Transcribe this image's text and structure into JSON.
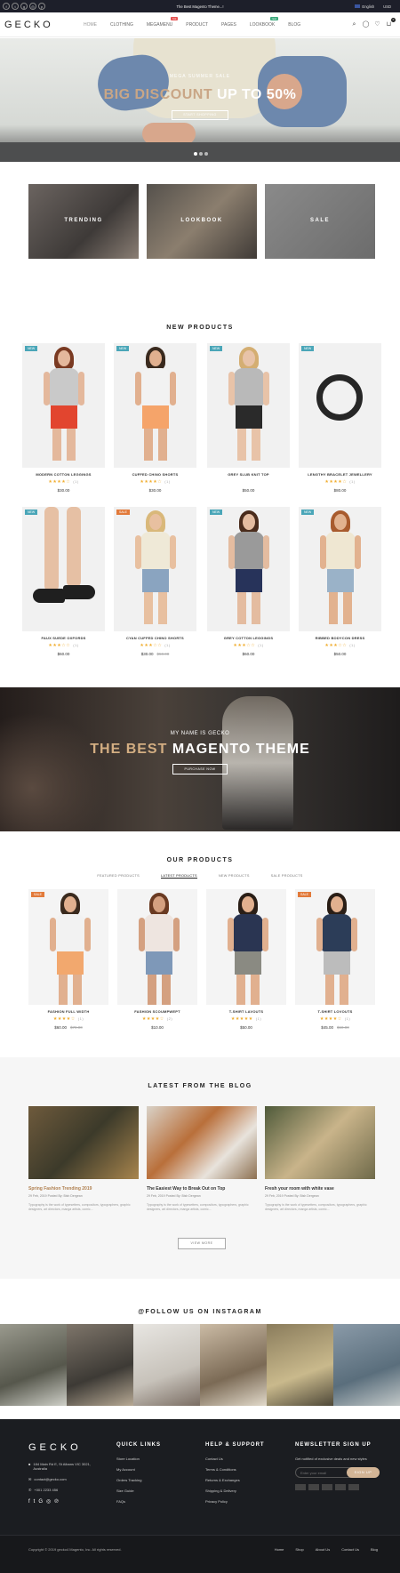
{
  "topbar": {
    "promo": "The Best Magento Theme...!",
    "language": "English",
    "currency": "USD",
    "social_icons": [
      "facebook-icon",
      "twitter-icon",
      "google-plus-icon",
      "instagram-icon",
      "pinterest-icon"
    ]
  },
  "header": {
    "logo": "GECKO",
    "nav": [
      {
        "label": "HOME"
      },
      {
        "label": "CLOTHING"
      },
      {
        "label": "MEGAMENU",
        "badge": "hot"
      },
      {
        "label": "PRODUCT"
      },
      {
        "label": "PAGES"
      },
      {
        "label": "LOOKBOOK",
        "badge": "new"
      },
      {
        "label": "BLOG"
      }
    ],
    "icons": [
      "search-icon",
      "user-icon",
      "heart-icon",
      "cart-icon"
    ],
    "cart_count": "0"
  },
  "hero": {
    "subtitle": "MEGA SUMMER SALE",
    "title_a": "BIG DISCOUNT",
    "title_b": " UP TO 50%",
    "button": "START SHOPPING"
  },
  "categories": [
    "TRENDING",
    "LOOKBOOK",
    "SALE"
  ],
  "new_products": {
    "title": "NEW PRODUCTS",
    "items": [
      {
        "tag": "NEW",
        "name": "MODERN COTTON LEGGINGS",
        "stars": "★★★★☆",
        "reviews": "(1)",
        "price": "$30.00",
        "old": ""
      },
      {
        "tag": "NEW",
        "name": "CUFFED CHINO SHORTS",
        "stars": "★★★★☆",
        "reviews": "(1)",
        "price": "$30.00",
        "old": ""
      },
      {
        "tag": "NEW",
        "name": "GREY SLUB KNIT TOP",
        "stars": "",
        "reviews": "",
        "price": "$50.00",
        "old": ""
      },
      {
        "tag": "NEW",
        "name": "LENGTHY BRACELET JEWELLERY",
        "stars": "★★★★☆",
        "reviews": "(1)",
        "price": "$80.00",
        "old": ""
      },
      {
        "tag": "NEW",
        "name": "FAUX SUEDE OXFORDS",
        "stars": "★★★☆☆",
        "reviews": "(1)",
        "price": "$60.00",
        "old": ""
      },
      {
        "tag": "SALE",
        "name": "CYAN CUFFED CHINO SHORTS",
        "stars": "★★★☆☆",
        "reviews": "(1)",
        "price": "$30.00",
        "old": "$50.00"
      },
      {
        "tag": "NEW",
        "name": "GREY COTTON LEGGINGS",
        "stars": "★★★☆☆",
        "reviews": "(1)",
        "price": "$60.00",
        "old": ""
      },
      {
        "tag": "NEW",
        "name": "RIBBED BODYCON DRESS",
        "stars": "★★★☆☆",
        "reviews": "(1)",
        "price": "$50.00",
        "old": ""
      }
    ]
  },
  "banner": {
    "subtitle": "MY NAME IS GECKO",
    "title_a": "THE BEST ",
    "title_b": "MAGENTO THEME",
    "button": "PURCHASE NOW"
  },
  "our_products": {
    "title": "OUR PRODUCTS",
    "tabs": [
      "FEATURED PRODUCTS",
      "LATEST PRODUCTS",
      "NEW PRODUCTS",
      "SALE PRODUCTS"
    ],
    "items": [
      {
        "tag": "SALE",
        "name": "FASHION FULL WIDTH",
        "stars": "★★★★☆",
        "reviews": "(1)",
        "price": "$60.00",
        "old": "$70.00"
      },
      {
        "tag": "",
        "name": "FASHION SCOUMPWEPT",
        "stars": "★★★★☆",
        "reviews": "(2)",
        "price": "$10.00",
        "old": ""
      },
      {
        "tag": "",
        "name": "T-SHIRT LAVOUTS",
        "stars": "★★★★★",
        "reviews": "(1)",
        "price": "$50.00",
        "old": ""
      },
      {
        "tag": "SALE",
        "name": "T-SHIRT LOVOUTS",
        "stars": "★★★★☆",
        "reviews": "(1)",
        "price": "$45.00",
        "old": "$60.00"
      }
    ]
  },
  "blog": {
    "title": "LATEST FROM THE BLOG",
    "posts": [
      {
        "title": "Spring Fashion Trending 2019",
        "meta": "29 Feb, 2019    Posted By: Bish Dergean",
        "excerpt": "Typography is the work of typesetters, compositors, typographers, graphic designers, art directors, manga artists, comic..."
      },
      {
        "title": "The Easiest Way to Break Out on Top",
        "meta": "29 Feb, 2019    Posted By: Bish Dergean",
        "excerpt": "Typography is the work of typesetters, compositors, typographers, graphic designers, art directors, manga artists, comic..."
      },
      {
        "title": "Fresh your room with white vase",
        "meta": "29 Feb, 2019    Posted By: Bish Dergean",
        "excerpt": "Typography is the work of typesetters, compositors, typographers, graphic designers, art directors, manga artists, comic..."
      }
    ],
    "button": "VIEW MORE"
  },
  "instagram": {
    "title": "@FOLLOW US ON INSTAGRAM"
  },
  "footer": {
    "logo": "GECKO",
    "address": "184 Main Rd E, St Albans VIC 3021, Australia",
    "email": "contact@gecko.com",
    "phone": "+001 2233 456",
    "quick_title": "QUICK LINKS",
    "quick_links": [
      "Store Location",
      "My Account",
      "Orders Tracking",
      "Size Guide",
      "FAQs"
    ],
    "help_title": "HELP & SUPPORT",
    "help_links": [
      "Contact Us",
      "Terms & Conditions",
      "Returns & Exchanges",
      "Shipping & Delivery",
      "Privacy Policy"
    ],
    "newsletter_title": "NEWSLETTER SIGN UP",
    "newsletter_text": "Get notified of exclusive deals and new styles",
    "email_placeholder": "Enter your email",
    "signup_button": "SIGN UP",
    "copyright": "Copyright © 2019 gecko4 Magento, Inc. All rights reserved.",
    "bottom_links": [
      "Home",
      "Shop",
      "About Us",
      "Contact Us",
      "Blog"
    ]
  }
}
